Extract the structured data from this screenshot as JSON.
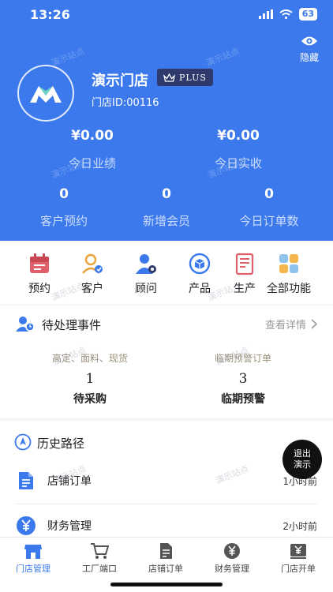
{
  "status_bar": {
    "time": "13:26",
    "battery": "63"
  },
  "header": {
    "hide_label": "隐藏",
    "store_name": "演示门店",
    "plus_badge": "PLUS",
    "store_id": "门店ID:00116",
    "stats_row1": [
      {
        "value": "¥0.00",
        "label": "今日业绩"
      },
      {
        "value": "¥0.00",
        "label": "今日实收"
      }
    ],
    "stats_row2": [
      {
        "value": "0",
        "label": "客户预约"
      },
      {
        "value": "0",
        "label": "新增会员"
      },
      {
        "value": "0",
        "label": "今日订单数"
      }
    ]
  },
  "quick_menu": [
    {
      "label": "预约",
      "icon": "calendar-icon"
    },
    {
      "label": "客户",
      "icon": "customer-icon"
    },
    {
      "label": "顾问",
      "icon": "advisor-icon"
    },
    {
      "label": "产品",
      "icon": "product-icon"
    },
    {
      "label": "生产",
      "icon": "production-icon"
    },
    {
      "label": "全部功能",
      "icon": "all-functions-icon"
    }
  ],
  "pending": {
    "title": "待处理事件",
    "view_details": "查看详情",
    "items": [
      {
        "subtitle": "高定、面料、现货",
        "count": "1",
        "label": "待采购"
      },
      {
        "subtitle": "临期预警订单",
        "count": "3",
        "label": "临期预警"
      }
    ]
  },
  "history": {
    "title": "历史路径",
    "items": [
      {
        "label": "店铺订单",
        "time": "1小时前"
      },
      {
        "label": "财务管理",
        "time": "2小时前"
      }
    ]
  },
  "exit_demo": {
    "line1": "退出",
    "line2": "演示"
  },
  "watermark": "演示站点",
  "tabs": [
    {
      "label": "门店管理",
      "active": true
    },
    {
      "label": "工厂端口"
    },
    {
      "label": "店铺订单"
    },
    {
      "label": "财务管理"
    },
    {
      "label": "门店开单"
    }
  ],
  "colors": {
    "primary": "#3b79ec",
    "badge": "#2d3a6b"
  }
}
